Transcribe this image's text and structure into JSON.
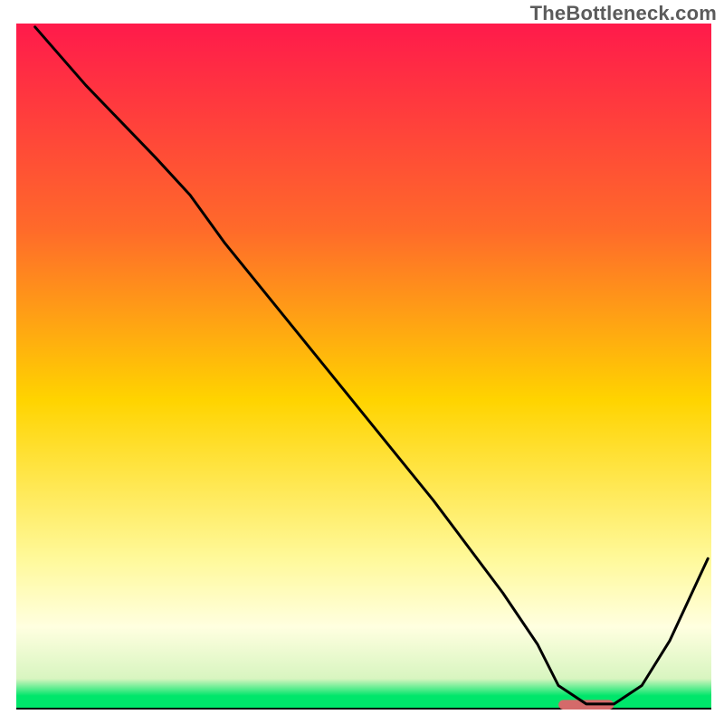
{
  "watermark": "TheBottleneck.com",
  "chart_data": {
    "type": "line",
    "title": "",
    "xlabel": "",
    "ylabel": "",
    "xlim": [
      0,
      100
    ],
    "ylim": [
      0,
      100
    ],
    "axes": {
      "visible": false,
      "grid": false,
      "ticks": []
    },
    "background_gradient": {
      "direction": "vertical",
      "stops": [
        {
          "pos": 0.0,
          "color": "#ff1a4b"
        },
        {
          "pos": 0.3,
          "color": "#ff6a2a"
        },
        {
          "pos": 0.55,
          "color": "#ffd400"
        },
        {
          "pos": 0.78,
          "color": "#fff99a"
        },
        {
          "pos": 0.88,
          "color": "#ffffe0"
        },
        {
          "pos": 0.955,
          "color": "#d8f5c0"
        },
        {
          "pos": 0.98,
          "color": "#00e66b"
        },
        {
          "pos": 1.0,
          "color": "#00e66b"
        }
      ]
    },
    "series": [
      {
        "name": "bottleneck-curve",
        "color": "#000000",
        "stroke_width": 3,
        "x": [
          2.7,
          10,
          20,
          25,
          30,
          40,
          50,
          60,
          70,
          75,
          78,
          82,
          86,
          90,
          94,
          99.5
        ],
        "values": [
          99.5,
          91,
          80.5,
          75,
          68,
          55.5,
          43,
          30.5,
          17,
          9.5,
          3.5,
          0.8,
          0.8,
          3.5,
          10,
          22
        ]
      }
    ],
    "markers": [
      {
        "name": "optimal-range-marker",
        "shape": "rounded-bar",
        "color": "#d46a6a",
        "x_start": 78,
        "x_end": 86,
        "y": 0.7,
        "height_pct": 1.4
      }
    ]
  }
}
